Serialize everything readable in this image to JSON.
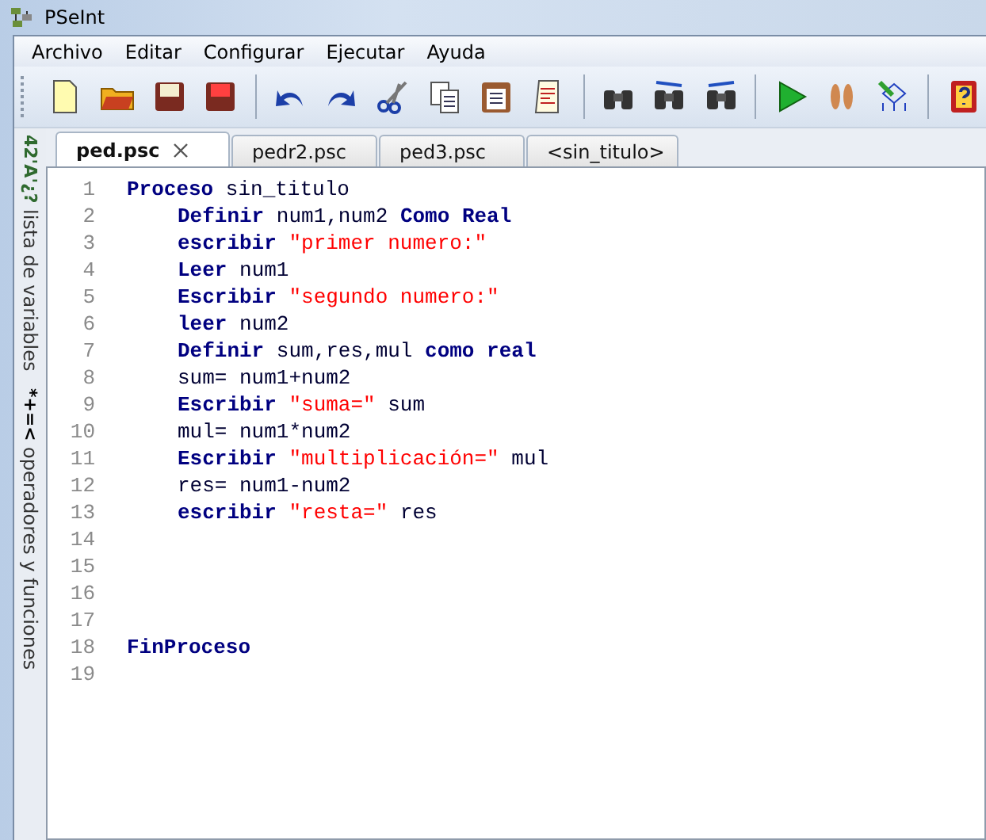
{
  "window": {
    "title": "PSeInt"
  },
  "menu": [
    "Archivo",
    "Editar",
    "Configurar",
    "Ejecutar",
    "Ayuda"
  ],
  "tabs": [
    {
      "label": "ped.psc",
      "selected": true
    },
    {
      "label": "pedr2.psc",
      "selected": false
    },
    {
      "label": "ped3.psc",
      "selected": false
    },
    {
      "label": "<sin_titulo>",
      "selected": false
    }
  ],
  "side_panels": [
    {
      "glyphs": "42'A'¿?",
      "label": "lista de variables"
    },
    {
      "glyphs": "*+=<",
      "label": "operadores y funciones"
    }
  ],
  "code_lines": [
    {
      "number": "1",
      "tokens": [
        {
          "kind": "keyword",
          "text": "Proceso"
        },
        {
          "kind": "plain",
          "text": " sin_titulo"
        }
      ],
      "children": [
        {
          "number": "2",
          "tokens": [
            {
              "kind": "keyword",
              "text": "Definir"
            },
            {
              "kind": "plain",
              "text": " num1,num2 "
            },
            {
              "kind": "keyword",
              "text": "Como Real"
            }
          ]
        },
        {
          "number": "3",
          "tokens": [
            {
              "kind": "keyword",
              "text": "escribir "
            },
            {
              "kind": "string",
              "text": "\"primer numero:\""
            }
          ]
        },
        {
          "number": "4",
          "tokens": [
            {
              "kind": "keyword",
              "text": "Leer"
            },
            {
              "kind": "plain",
              "text": " num1"
            }
          ]
        },
        {
          "number": "5",
          "tokens": [
            {
              "kind": "keyword",
              "text": "Escribir "
            },
            {
              "kind": "string",
              "text": "\"segundo numero:\""
            }
          ]
        },
        {
          "number": "6",
          "tokens": [
            {
              "kind": "keyword",
              "text": "leer"
            },
            {
              "kind": "plain",
              "text": " num2"
            }
          ]
        },
        {
          "number": "7",
          "tokens": [
            {
              "kind": "keyword",
              "text": "Definir"
            },
            {
              "kind": "plain",
              "text": " sum,res,mul "
            },
            {
              "kind": "keyword",
              "text": "como real"
            }
          ]
        },
        {
          "number": "8",
          "tokens": [
            {
              "kind": "plain",
              "text": "sum= num1+num2"
            }
          ]
        },
        {
          "number": "9",
          "tokens": [
            {
              "kind": "keyword",
              "text": "Escribir "
            },
            {
              "kind": "string",
              "text": "\"suma=\""
            },
            {
              "kind": "plain",
              "text": " sum"
            }
          ]
        },
        {
          "number": "10",
          "tokens": [
            {
              "kind": "plain",
              "text": "mul= num1*num2"
            }
          ]
        },
        {
          "number": "11",
          "tokens": [
            {
              "kind": "keyword",
              "text": "Escribir "
            },
            {
              "kind": "string",
              "text": "\"multiplicación=\""
            },
            {
              "kind": "plain",
              "text": " mul"
            }
          ]
        },
        {
          "number": "12",
          "tokens": [
            {
              "kind": "plain",
              "text": "res= num1-num2"
            }
          ]
        },
        {
          "number": "13",
          "tokens": [
            {
              "kind": "keyword",
              "text": "escribir "
            },
            {
              "kind": "string",
              "text": "\"resta=\""
            },
            {
              "kind": "plain",
              "text": " res"
            }
          ]
        }
      ]
    },
    {
      "number": "14"
    },
    {
      "number": "15"
    },
    {
      "number": "16"
    },
    {
      "number": "17"
    },
    {
      "number": "18",
      "tokens": [
        {
          "kind": "keyword",
          "text": "FinProceso"
        }
      ]
    },
    {
      "number": "19"
    }
  ]
}
